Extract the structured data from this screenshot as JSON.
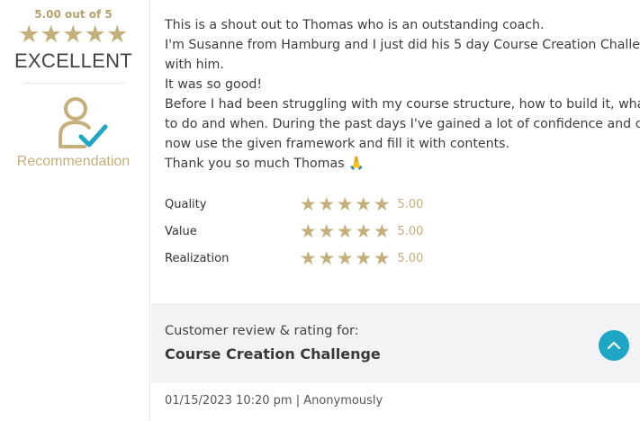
{
  "summary": {
    "score": "5.00 out of 5",
    "rating_word": "EXCELLENT",
    "recommendation_label": "Recommendation",
    "star_count": 5,
    "star_color": "#c5b07c"
  },
  "review": {
    "lines": [
      "This is a shout out to Thomas who is an outstanding coach.",
      "I'm Susanne from Hamburg and I just did his 5 day Course Creation Challenge",
      "with him.",
      "It was so good!",
      "Before I had been struggling with my course structure, how to build it, what",
      "to do and when. During the past days I've gained a lot of confidence and can",
      "now use the given framework and fill it with contents.",
      "Thank you so much Thomas 🙏"
    ]
  },
  "ratings": [
    {
      "label": "Quality",
      "value": "5.00",
      "stars": 5
    },
    {
      "label": "Value",
      "value": "5.00",
      "stars": 5
    },
    {
      "label": "Realization",
      "value": "5.00",
      "stars": 5
    }
  ],
  "footer": {
    "caption": "Customer review & rating for:",
    "title": "Course Creation Challenge",
    "meta": "01/15/2023 10:20 pm | Anonymously",
    "accent_color": "#1ea6c4"
  },
  "icons": {
    "recommendation": "user-check-icon",
    "scroll_up": "chevron-up-icon",
    "star": "star-icon"
  }
}
